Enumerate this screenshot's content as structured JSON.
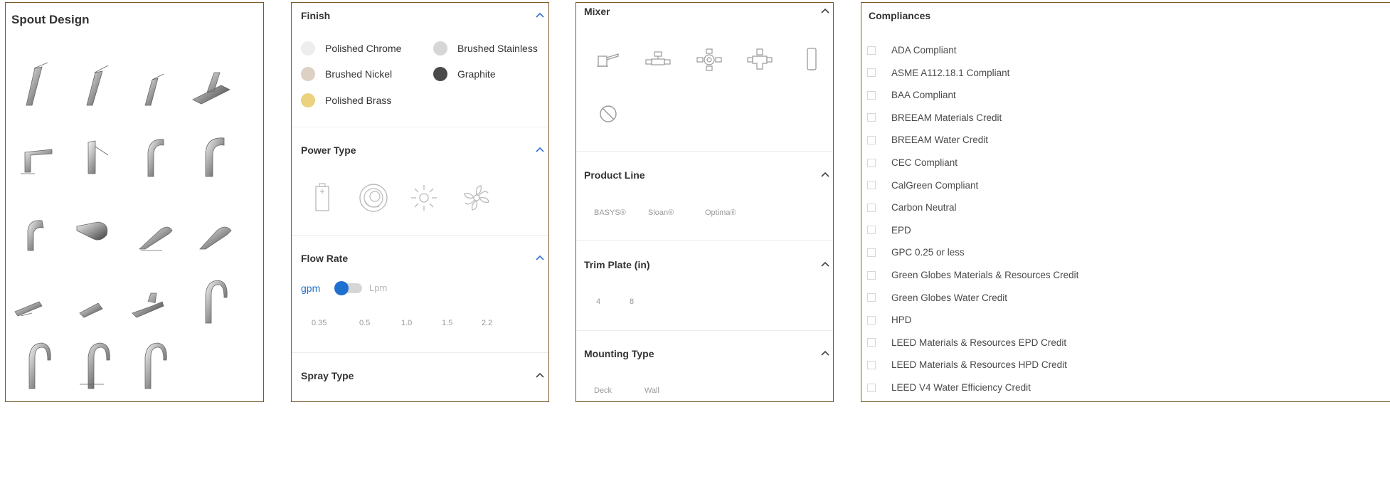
{
  "spout_design": {
    "title": "Spout Design",
    "items": [
      "spout-1",
      "spout-2",
      "spout-3",
      "spout-4",
      "spout-5",
      "spout-6",
      "spout-7",
      "spout-8",
      "spout-9",
      "spout-10",
      "spout-11",
      "spout-12",
      "spout-13",
      "spout-14",
      "spout-15",
      "spout-16",
      "spout-17",
      "spout-18",
      "spout-19"
    ]
  },
  "filters_a": {
    "finish": {
      "title": "Finish",
      "options": [
        {
          "label": "Polished Chrome",
          "color": "#ededed"
        },
        {
          "label": "Brushed Stainless",
          "color": "#d6d6d6"
        },
        {
          "label": "Brushed Nickel",
          "color": "#ddd1c4"
        },
        {
          "label": "Graphite",
          "color": "#4a4a4a"
        },
        {
          "label": "Polished Brass",
          "color": "#ecd27e"
        }
      ]
    },
    "power_type": {
      "title": "Power Type",
      "icons": [
        "battery-icon",
        "hydro-spiral-icon",
        "solar-icon",
        "turbine-icon"
      ]
    },
    "flow_rate": {
      "title": "Flow Rate",
      "unit_left": "gpm",
      "unit_right": "Lpm",
      "values": [
        "0.35",
        "0.5",
        "1.0",
        "1.5",
        "2.2"
      ]
    },
    "spray_type": {
      "title": "Spray Type"
    }
  },
  "filters_b": {
    "mixer": {
      "title": "Mixer",
      "icons": [
        "lever-mixer-icon",
        "tee-valve-icon",
        "thermostatic-valve-icon",
        "cross-valve-icon",
        "box-mixer-icon",
        "no-mixer-icon"
      ]
    },
    "product_line": {
      "title": "Product Line",
      "options": [
        "BASYS®",
        "Sloan®",
        "Optima®"
      ]
    },
    "trim_plate": {
      "title": "Trim Plate (in)",
      "options": [
        "4",
        "8"
      ]
    },
    "mounting_type": {
      "title": "Mounting Type",
      "options": [
        "Deck",
        "Wall"
      ]
    }
  },
  "compliances": {
    "title": "Compliances",
    "items": [
      "ADA Compliant",
      "ASME A112.18.1 Compliant",
      "BAA Compliant",
      "BREEAM Materials Credit",
      "BREEAM Water Credit",
      "CEC Compliant",
      "CalGreen Compliant",
      "Carbon Neutral",
      "EPD",
      "GPC 0.25 or less",
      "Green Globes Materials & Resources Credit",
      "Green Globes Water Credit",
      "HPD",
      "LEED Materials & Resources EPD Credit",
      "LEED Materials & Resources HPD Credit",
      "LEED V4 Water Efficiency Credit"
    ]
  },
  "colors": {
    "accent": "#1f6fd1",
    "border": "#7a5a2a",
    "chevron": "#2f6fd0"
  }
}
